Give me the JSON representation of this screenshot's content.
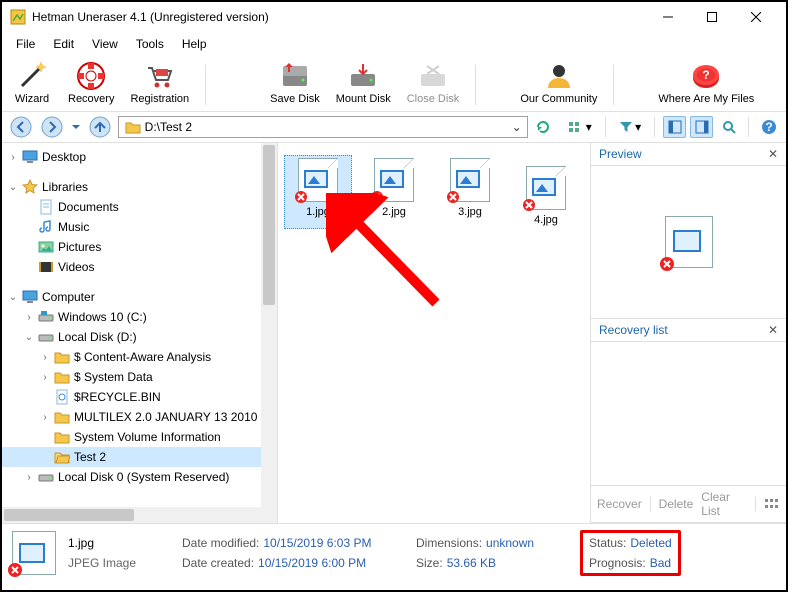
{
  "window": {
    "title": "Hetman Uneraser 4.1 (Unregistered version)"
  },
  "menu": {
    "file": "File",
    "edit": "Edit",
    "view": "View",
    "tools": "Tools",
    "help": "Help"
  },
  "toolbar": {
    "wizard": "Wizard",
    "recovery": "Recovery",
    "registration": "Registration",
    "savedisk": "Save Disk",
    "mountdisk": "Mount Disk",
    "closedisk": "Close Disk",
    "community": "Our Community",
    "where": "Where Are My Files"
  },
  "address": {
    "path": "D:\\Test 2"
  },
  "tree": {
    "desktop": "Desktop",
    "libraries": "Libraries",
    "documents": "Documents",
    "music": "Music",
    "pictures": "Pictures",
    "videos": "Videos",
    "computer": "Computer",
    "win10": "Windows 10 (C:)",
    "locald": "Local Disk (D:)",
    "caa": "$ Content-Aware Analysis",
    "sysdata": "$ System Data",
    "recycle": "$RECYCLE.BIN",
    "multilex": "MULTILEX 2.0 JANUARY 13 2010",
    "svi": "System Volume Information",
    "test2": "Test 2",
    "local0": "Local Disk 0 (System Reserved)"
  },
  "files": [
    "1.jpg",
    "2.jpg",
    "3.jpg",
    "4.jpg"
  ],
  "preview": {
    "title": "Preview"
  },
  "recovery": {
    "title": "Recovery list",
    "recover": "Recover",
    "delete": "Delete",
    "clear": "Clear List"
  },
  "details": {
    "name": "1.jpg",
    "type": "JPEG Image",
    "modified_k": "Date modified:",
    "modified_v": "10/15/2019 6:03 PM",
    "created_k": "Date created:",
    "created_v": "10/15/2019 6:00 PM",
    "dim_k": "Dimensions:",
    "dim_v": "unknown",
    "size_k": "Size:",
    "size_v": "53.66 KB",
    "status_k": "Status:",
    "status_v": "Deleted",
    "prog_k": "Prognosis:",
    "prog_v": "Bad"
  }
}
